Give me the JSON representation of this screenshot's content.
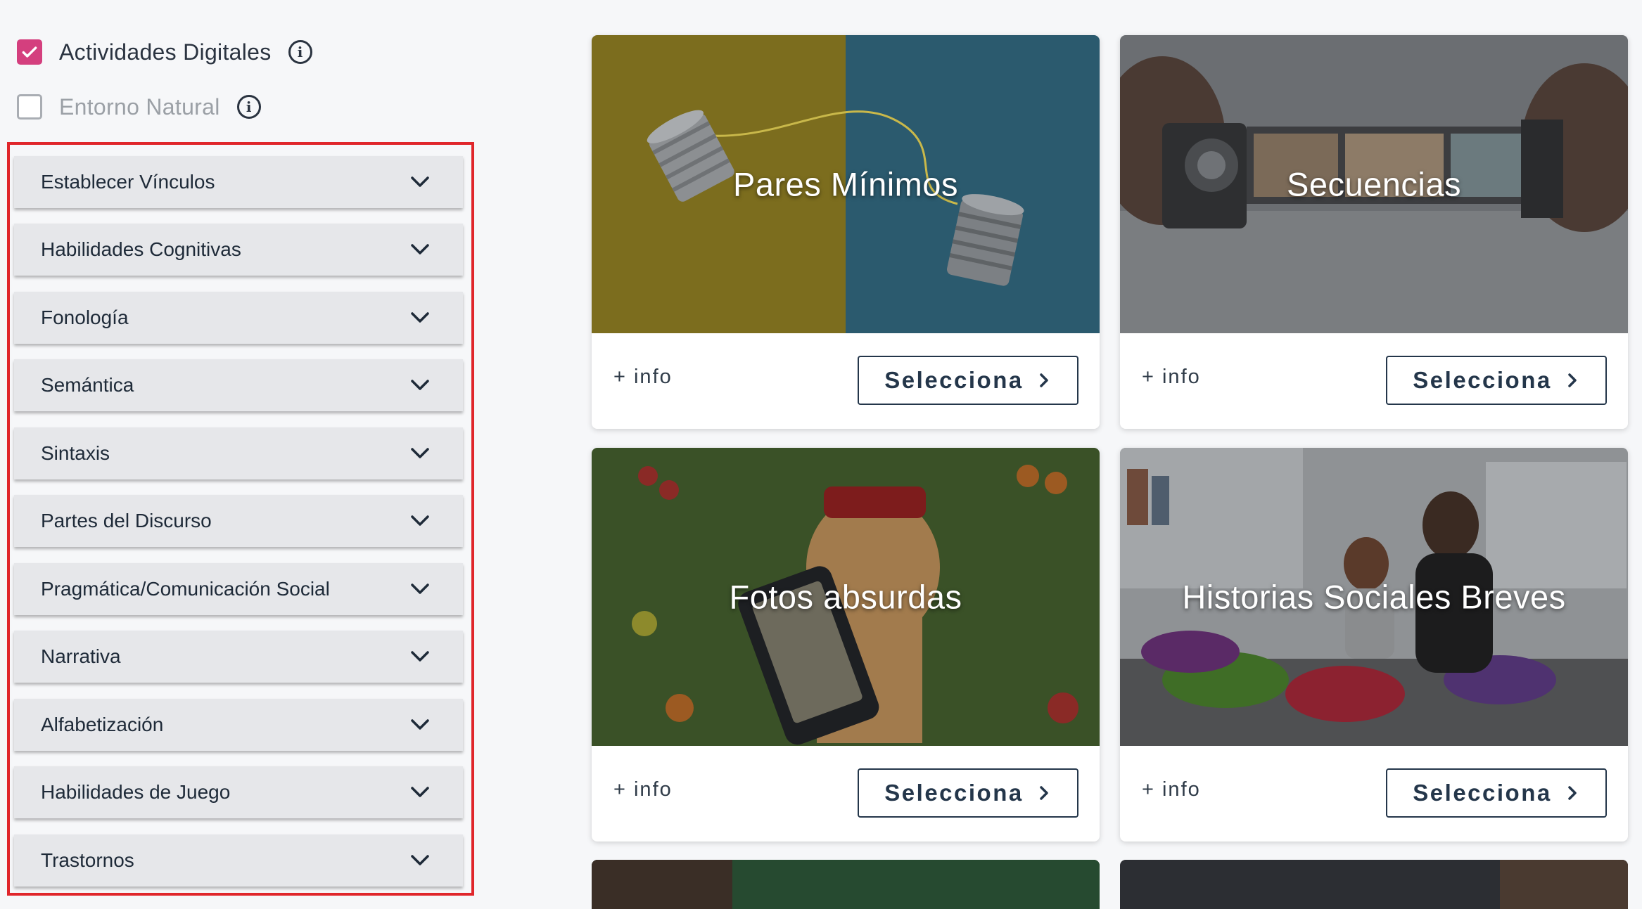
{
  "filters": [
    {
      "label": "Actividades Digitales",
      "checked": true
    },
    {
      "label": "Entorno Natural",
      "checked": false
    }
  ],
  "categories": [
    {
      "label": "Establecer Vínculos"
    },
    {
      "label": "Habilidades Cognitivas"
    },
    {
      "label": "Fonología"
    },
    {
      "label": "Semántica"
    },
    {
      "label": "Sintaxis"
    },
    {
      "label": "Partes del Discurso"
    },
    {
      "label": "Pragmática/Comunicación Social"
    },
    {
      "label": "Narrativa"
    },
    {
      "label": "Alfabetización"
    },
    {
      "label": "Habilidades de Juego"
    },
    {
      "label": "Trastornos"
    }
  ],
  "cards": [
    {
      "title": "Pares Mínimos",
      "info": "+ info",
      "button": "Selecciona"
    },
    {
      "title": "Secuencias",
      "info": "+ info",
      "button": "Selecciona"
    },
    {
      "title": "Fotos absurdas",
      "info": "+ info",
      "button": "Selecciona"
    },
    {
      "title": "Historias Sociales Breves",
      "info": "+ info",
      "button": "Selecciona"
    }
  ],
  "colors": {
    "checkbox_checked": "#d43f7e",
    "highlight_border": "#e0262b",
    "button_border": "#24364a"
  }
}
